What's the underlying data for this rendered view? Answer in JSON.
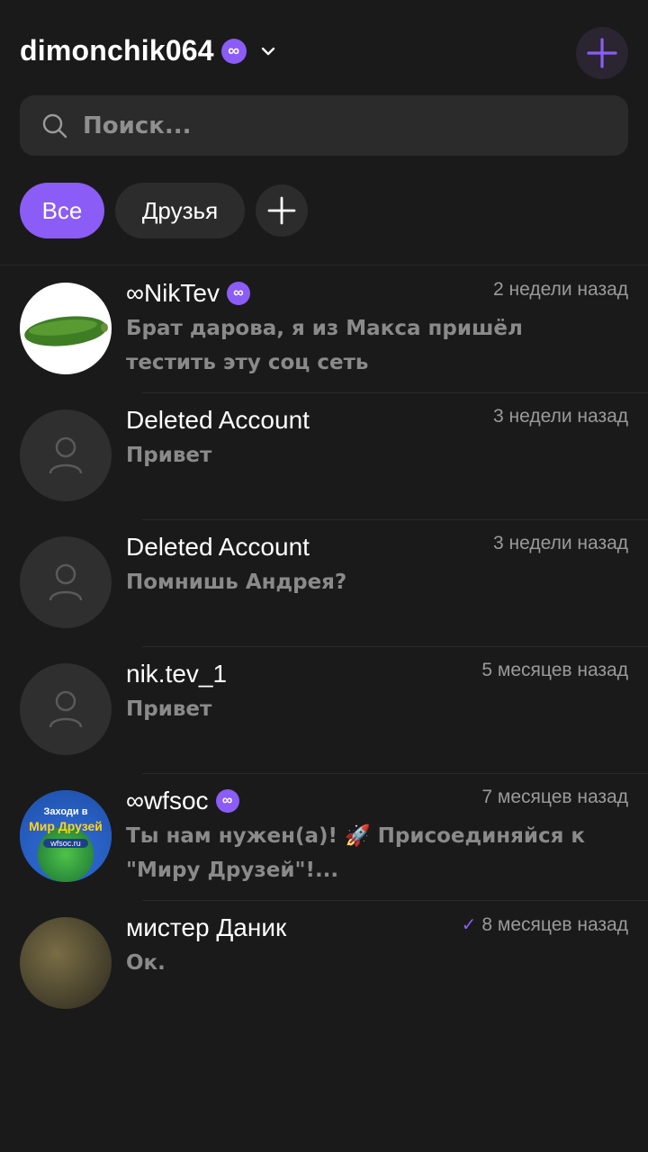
{
  "header": {
    "username": "dimonchik064",
    "verified_badge": "∞",
    "dropdown_icon": "chevron-down-icon",
    "new_chat_icon": "plus-icon"
  },
  "search": {
    "placeholder": "Поиск...",
    "icon": "search-icon"
  },
  "filters": {
    "items": [
      {
        "label": "Все",
        "active": true
      },
      {
        "label": "Друзья",
        "active": false
      }
    ],
    "add_icon": "plus-icon"
  },
  "chats": [
    {
      "name": "∞NikTev",
      "verified": true,
      "time": "2 недели назад",
      "message": "Брат дарова, я из Макса пришёл тестить эту соц сеть",
      "avatar": "cucumber-image"
    },
    {
      "name": "Deleted Account",
      "verified": false,
      "time": "3 недели назад",
      "message": "Привет",
      "avatar": "user-icon"
    },
    {
      "name": "Deleted Account",
      "verified": false,
      "time": "3 недели назад",
      "message": "Помнишь Андрея?",
      "avatar": "user-icon"
    },
    {
      "name": "nik.tev_1",
      "verified": false,
      "time": "5 месяцев назад",
      "message": "Привет",
      "avatar": "user-icon"
    },
    {
      "name": "∞wfsoc",
      "verified": true,
      "time": "7 месяцев назад",
      "message": " Ты нам нужен(а)! 🚀 Присоединяйся к \"Миру Друзей\"!...",
      "avatar": "wfsoc-logo",
      "avatar_text_1": "Заходи в",
      "avatar_text_2": "Мир Друзей",
      "avatar_text_3": "wfsoc.ru"
    },
    {
      "name": "мистер Даник",
      "verified": false,
      "time": "8 месяцев назад",
      "message": "Ок.",
      "read": true,
      "avatar": "photo"
    }
  ],
  "colors": {
    "accent": "#8b5cf6",
    "background": "#1a1a1a"
  }
}
